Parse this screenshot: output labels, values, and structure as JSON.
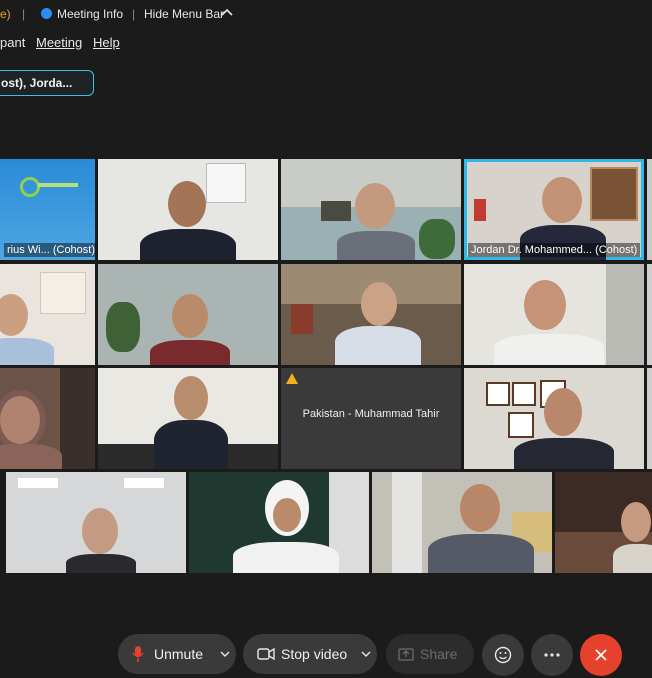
{
  "topbar": {
    "left_fragment": "e)",
    "separator": "|",
    "meeting_info": "Meeting Info",
    "hide_menu_bar": "Hide Menu Bar",
    "caret": "^"
  },
  "menubar": {
    "items": [
      "pant",
      "Meeting",
      "Help"
    ]
  },
  "speaker_pill": {
    "label": "ost), Jorda..."
  },
  "tiles": {
    "r1c1": {
      "name": "rius Wi... (Cohost)"
    },
    "r1c4": {
      "name": "Jordan Dr. Mohammed... (Cohost)"
    },
    "r3c3": {
      "name": "Pakistan - Muhammad Tahir"
    }
  },
  "controls": {
    "unmute": "Unmute",
    "stop_video": "Stop video",
    "share": "Share"
  },
  "colors": {
    "active_border": "#2fb9e6",
    "leave_button": "#e5412d",
    "mute_icon": "#e5412d",
    "warning_icon": "#f2b01e"
  }
}
